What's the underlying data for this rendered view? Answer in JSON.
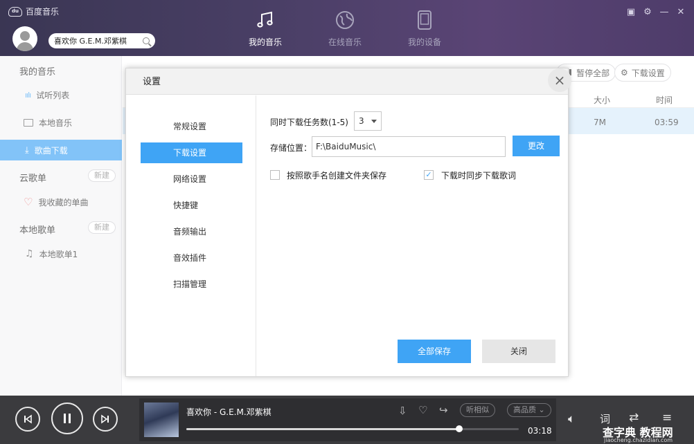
{
  "app": {
    "title": "百度音乐",
    "logo_text": "du"
  },
  "search": {
    "value": "喜欢你 G.E.M.邓紫棋"
  },
  "nav": {
    "tabs": [
      {
        "label": "我的音乐",
        "icon": "music-note-icon",
        "active": true
      },
      {
        "label": "在线音乐",
        "icon": "globe-icon",
        "active": false
      },
      {
        "label": "我的设备",
        "icon": "phone-device-icon",
        "active": false
      }
    ]
  },
  "sidebar": {
    "my_music_title": "我的音乐",
    "items": [
      {
        "label": "试听列表",
        "icon": "bars-icon"
      },
      {
        "label": "本地音乐",
        "icon": "monitor-icon"
      },
      {
        "label": "歌曲下载",
        "icon": "download-icon",
        "active": true
      }
    ],
    "cloud_title": "云歌单",
    "cloud_new": "新建",
    "cloud_items": [
      {
        "label": "我收藏的单曲",
        "icon": "heart-icon"
      }
    ],
    "local_title": "本地歌单",
    "local_new": "新建",
    "local_items": [
      {
        "label": "本地歌单1",
        "icon": "music-note-icon"
      }
    ]
  },
  "main": {
    "pause_all": "暂停全部",
    "download_settings": "下载设置",
    "col_size": "大小",
    "col_time": "时间",
    "row": {
      "size": "7M",
      "time": "03:59"
    }
  },
  "dialog": {
    "title": "设置",
    "nav": [
      "常规设置",
      "下载设置",
      "网络设置",
      "快捷键",
      "音频输出",
      "音效插件",
      "扫描管理"
    ],
    "active_nav_index": 1,
    "tasks_label": "同时下载任务数(1-5)",
    "tasks_value": "3",
    "storage_label": "存储位置：",
    "storage_path": "F:\\BaiduMusic\\",
    "change_btn": "更改",
    "opt_folder": {
      "label": "按照歌手名创建文件夹保存",
      "checked": false
    },
    "opt_lyrics": {
      "label": "下载时同步下载歌词",
      "checked": true
    },
    "save_btn": "全部保存",
    "close_btn": "关闭"
  },
  "player": {
    "song": "喜欢你 - G.E.M.邓紫棋",
    "time": "03:18",
    "progress": 0.82,
    "similar": "听相似",
    "quality": "高品质"
  },
  "watermark": {
    "main": "查字典 教程网",
    "sub": "jiaocheng.chazidian.com"
  }
}
